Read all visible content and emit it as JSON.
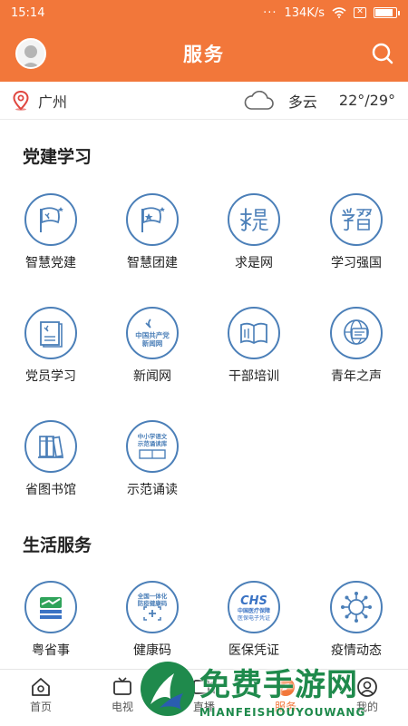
{
  "status_bar": {
    "time": "15:14",
    "speed": "134K/s",
    "battery_level": 0.9
  },
  "header": {
    "title": "服务"
  },
  "location": {
    "city": "广州",
    "weather": "多云",
    "temp": "22°/29°"
  },
  "sections": [
    {
      "title": "党建学习",
      "items": [
        {
          "label": "智慧党建",
          "icon": "party-flag-icon"
        },
        {
          "label": "智慧团建",
          "icon": "league-flag-icon"
        },
        {
          "label": "求是网",
          "icon": "qiushi-calligraphy-icon"
        },
        {
          "label": "学习强国",
          "icon": "xuexi-calligraphy-icon"
        },
        {
          "label": "党员学习",
          "icon": "party-book-icon"
        },
        {
          "label": "新闻网",
          "icon": "news-emblem-icon",
          "icon_text": [
            "中国共产党",
            "新闻网"
          ]
        },
        {
          "label": "干部培训",
          "icon": "open-book-icon"
        },
        {
          "label": "青年之声",
          "icon": "globe-chat-icon"
        },
        {
          "label": "省图书馆",
          "icon": "books-icon"
        },
        {
          "label": "示范诵读",
          "icon": "reading-badge-icon",
          "icon_text": [
            "中小学语文",
            "示范诵读库"
          ]
        }
      ]
    },
    {
      "title": "生活服务",
      "items": [
        {
          "label": "粤省事",
          "icon": "yue-shengshi-icon"
        },
        {
          "label": "健康码",
          "icon": "health-code-icon",
          "icon_text": [
            "全国一体化",
            "防疫健康码"
          ]
        },
        {
          "label": "医保凭证",
          "icon": "chs-icon",
          "icon_text": [
            "CHS",
            "中国医疗保障",
            "医保电子凭证"
          ]
        },
        {
          "label": "疫情动态",
          "icon": "virus-icon"
        }
      ]
    }
  ],
  "nav": [
    {
      "label": "首页",
      "icon": "home-icon"
    },
    {
      "label": "电视",
      "icon": "tv-icon"
    },
    {
      "label": "直播",
      "icon": "live-icon"
    },
    {
      "label": "服务",
      "icon": "service-icon"
    },
    {
      "label": "我的",
      "icon": "profile-icon"
    }
  ],
  "watermark": {
    "text": "免费手游网",
    "sub": "MIANFEISHOUYOUWANG"
  },
  "colors": {
    "accent": "#f2773a",
    "icon_blue": "#4b7fb8",
    "watermark": "#1f8a4c"
  }
}
